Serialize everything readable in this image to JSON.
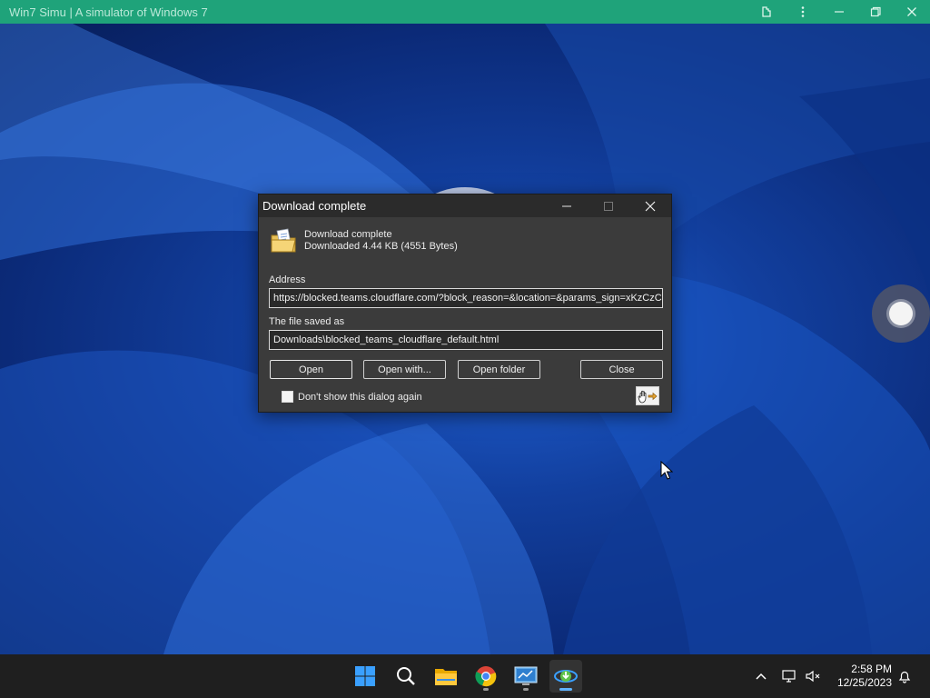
{
  "emulator": {
    "title": "Win7 Simu | A simulator of Windows 7"
  },
  "dialog": {
    "title": "Download complete",
    "heading": "Download complete",
    "detail": "Downloaded 4.44  KB (4551 Bytes)",
    "address_label": "Address",
    "address_value": "https://blocked.teams.cloudflare.com/?block_reason=&location=&params_sign=xKzCzCV",
    "saved_label": "The file saved as",
    "saved_value": "Downloads\\blocked_teams_cloudflare_default.html",
    "buttons": {
      "open": "Open",
      "open_with": "Open with...",
      "open_folder": "Open folder",
      "close": "Close"
    },
    "checkbox_label": "Don't show this dialog again",
    "checkbox_checked": false
  },
  "taskbar": {
    "apps": [
      "start-icon",
      "search-icon",
      "file-explorer-icon",
      "chrome-icon",
      "control-panel-icon",
      "download-manager-icon"
    ],
    "time": "2:58 PM",
    "date": "12/25/2023"
  },
  "colors": {
    "emulator_bar": "#1fa37a",
    "dialog_bg": "#3b3b3b",
    "taskbar_bg": "#1f1f1f",
    "accent": "#5fb3ff"
  }
}
